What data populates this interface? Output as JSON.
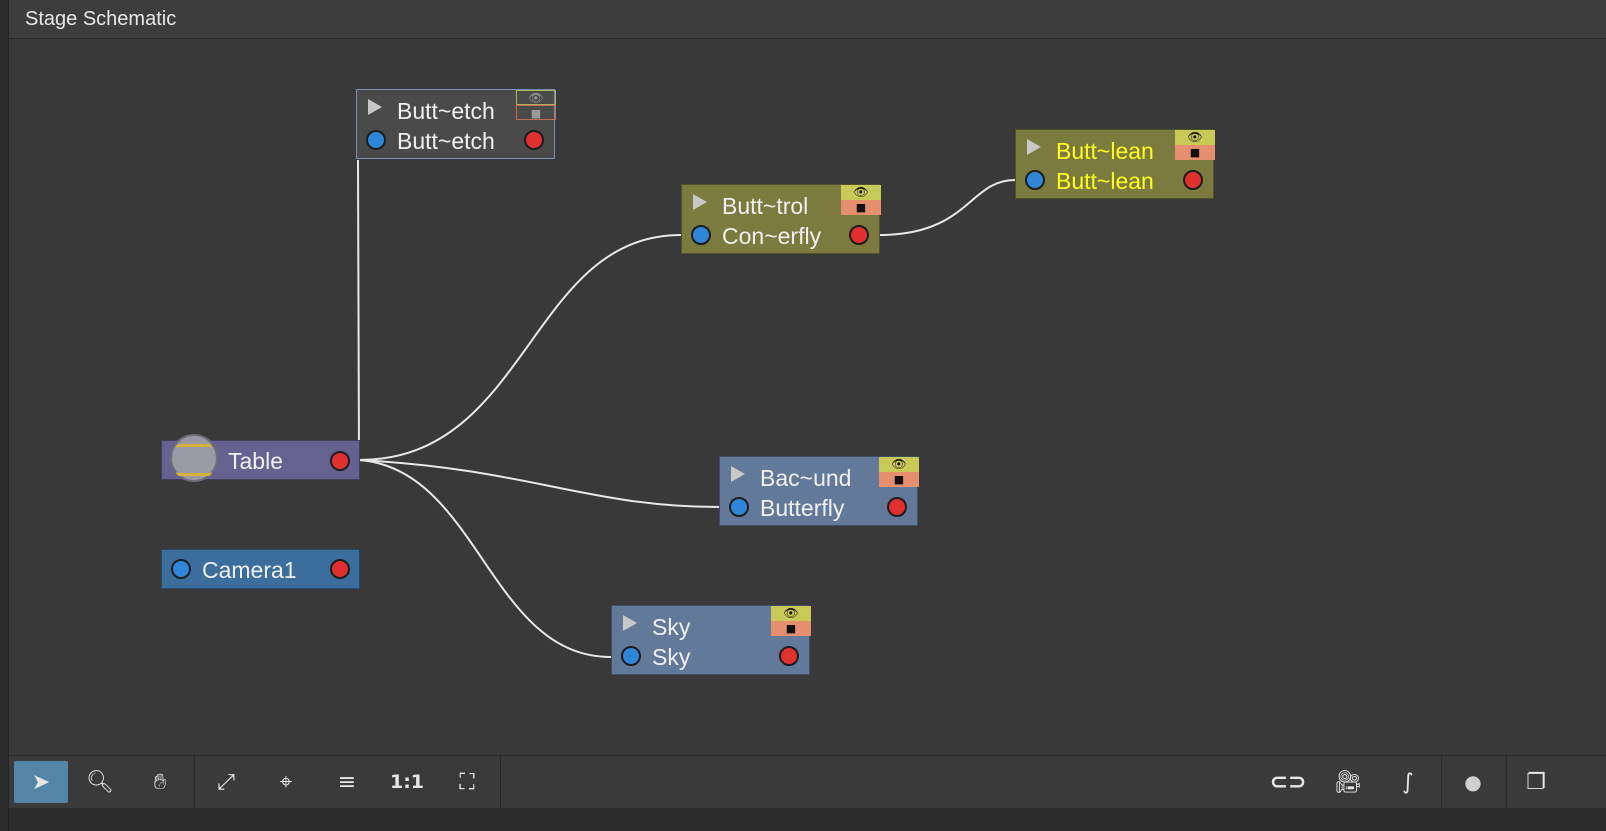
{
  "panel": {
    "title": "Stage Schematic"
  },
  "nodes": {
    "butt_etch": {
      "top": "Butt~etch",
      "bottom": "Butt~etch"
    },
    "butt_trol": {
      "top": "Butt~trol",
      "bottom": "Con~erfly"
    },
    "butt_lean": {
      "top": "Butt~lean",
      "bottom": "Butt~lean"
    },
    "table": {
      "label": "Table"
    },
    "background": {
      "top": "Bac~und",
      "bottom": "Butterfly"
    },
    "camera": {
      "label": "Camera1"
    },
    "sky": {
      "top": "Sky",
      "bottom": "Sky"
    }
  },
  "toolbar": {
    "select": "➤",
    "zoom": "🔍︎",
    "pan": "✋︎",
    "fit": "⤢",
    "focus": "⌖",
    "reorder": "≡",
    "actual": "1:1",
    "frame": "⛶",
    "output": "⊂⊃",
    "camera": "🎥︎",
    "curve": "∫",
    "toggle": "●",
    "window": "❐"
  },
  "colors": {
    "yellow_node": "#7b7b3f",
    "blue_node": "#62799a",
    "purple_node": "#65628f",
    "camera_node": "#3b6e9d",
    "grey_node": "#4a4a4a",
    "active_tool": "#5285a6"
  }
}
